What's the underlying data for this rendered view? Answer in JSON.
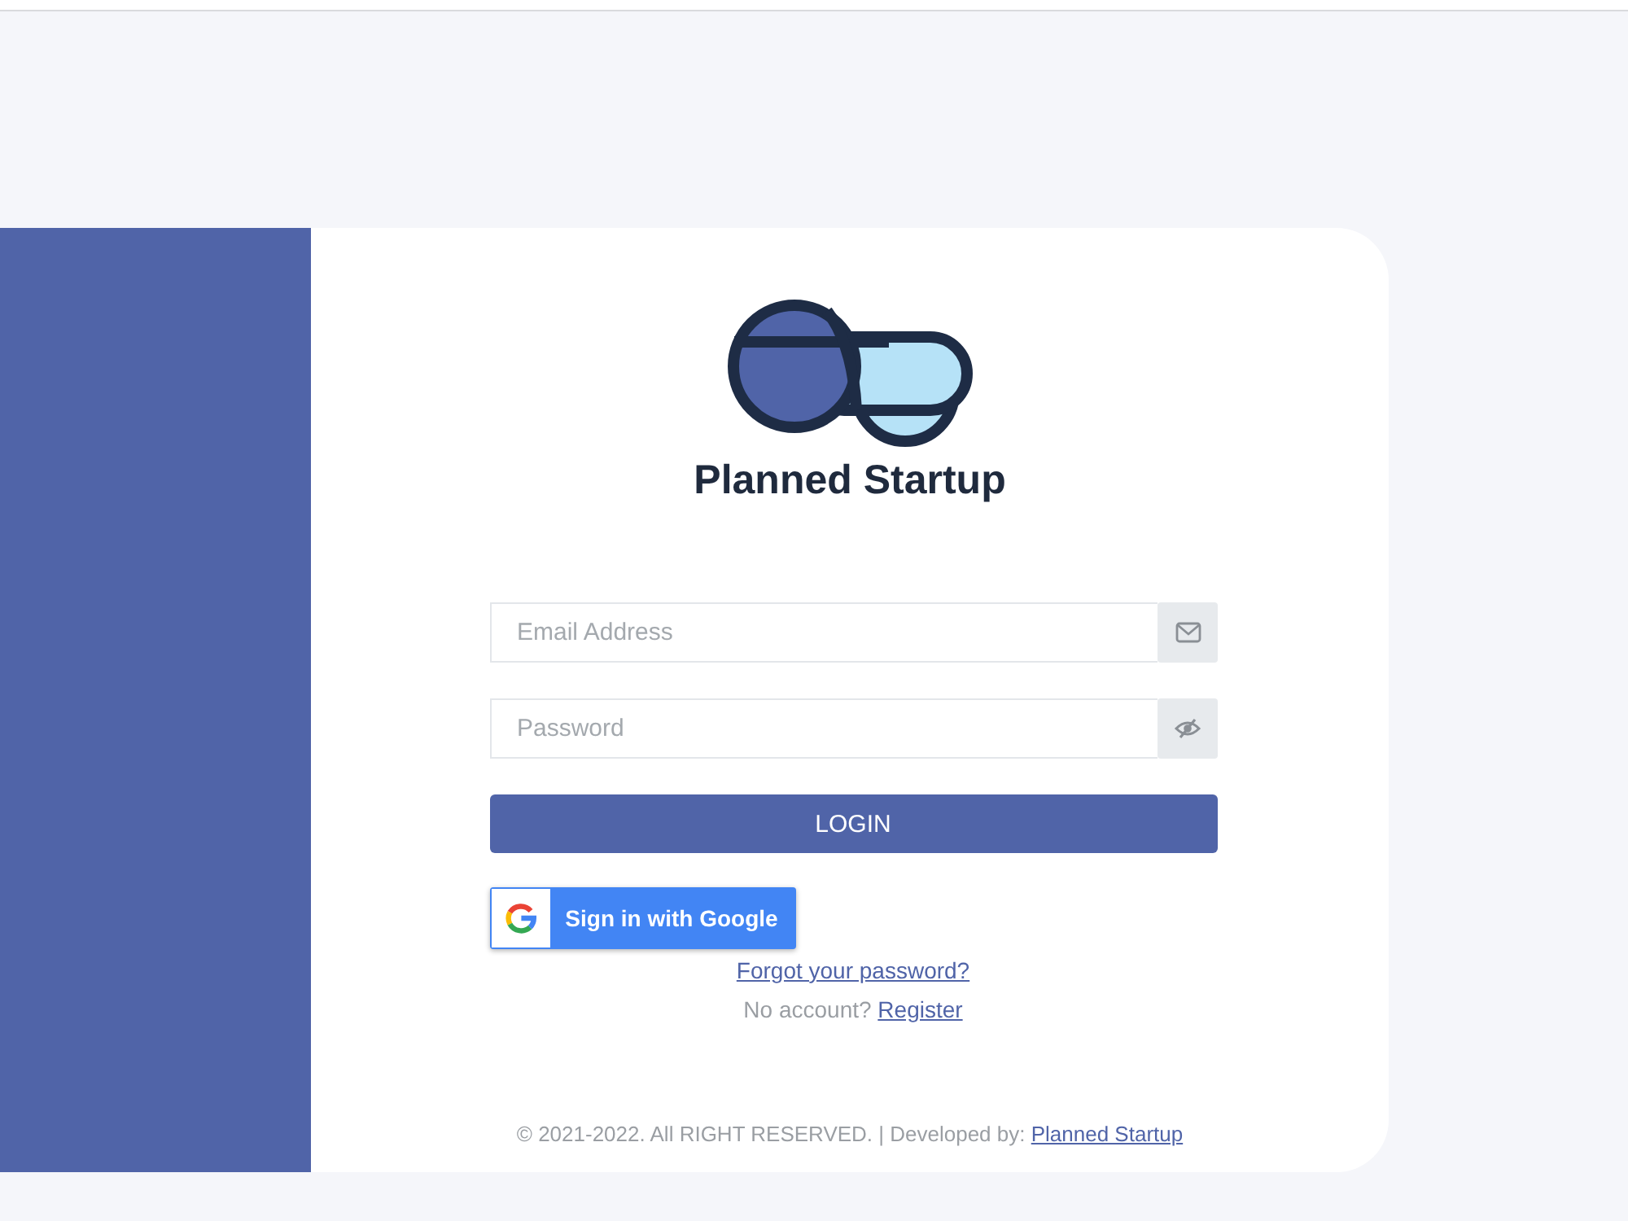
{
  "brand": {
    "name": "Planned Startup"
  },
  "form": {
    "fields": [
      {
        "kind": "email",
        "placeholder": "Email Address"
      },
      {
        "kind": "password",
        "placeholder": "Password"
      }
    ],
    "login_button": "LOGIN",
    "google_button": "Sign in with Google",
    "forgot_link": "Forgot your password?",
    "register": {
      "prompt": "No account?",
      "link": "Register"
    }
  },
  "footer": {
    "text": "© 2021-2022. All RIGHT RESERVED. | Developed by:",
    "link": "Planned Startup"
  }
}
